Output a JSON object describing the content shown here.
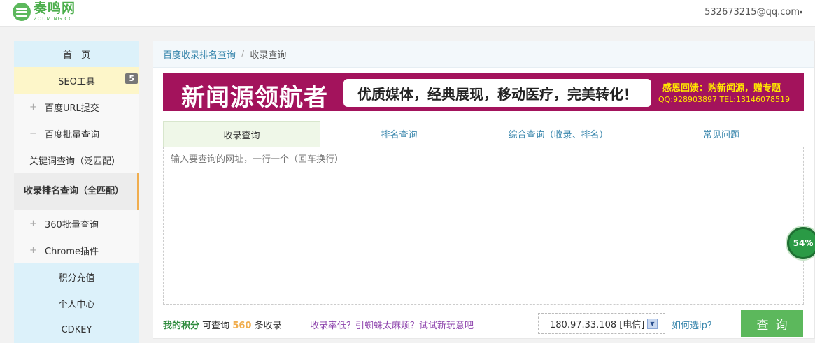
{
  "header": {
    "logo_cn": "奏鸣网",
    "logo_en": "ZOUMING.CC",
    "user_email": "532673215@qq.com"
  },
  "sidebar": {
    "items": [
      {
        "label": "首　页"
      },
      {
        "label": "SEO工具",
        "badge": "5"
      },
      {
        "label": "百度URL提交",
        "prefix": "+"
      },
      {
        "label": "百度批量查询",
        "prefix": "−"
      },
      {
        "label": "关键词查询（泛匹配）"
      },
      {
        "label": "收录排名查询（全匹配）"
      },
      {
        "label": "360批量查询",
        "prefix": "+"
      },
      {
        "label": "Chrome插件",
        "prefix": "+"
      },
      {
        "label": "积分充值"
      },
      {
        "label": "个人中心"
      },
      {
        "label": "CDKEY"
      }
    ]
  },
  "breadcrumb": {
    "parent": "百度收录排名查询",
    "separator": "/",
    "current": "收录查询"
  },
  "banner": {
    "headline": "新闻源领航者",
    "slogan": "优质媒体，经典展现，移动医疗，完美转化！",
    "promo": "感恩回馈：购新闻源，赠专题",
    "contact": "QQ:928903897 TEL:13146078519"
  },
  "tabs": [
    {
      "label": "收录查询",
      "active": true
    },
    {
      "label": "排名查询"
    },
    {
      "label": "综合查询（收录、排名）"
    },
    {
      "label": "常见问题"
    }
  ],
  "query_input": {
    "placeholder": "输入要查询的网址，一行一个（回车换行）",
    "value": ""
  },
  "footer": {
    "points_label": "我的积分",
    "points_text_pre": "可查询",
    "points_value": "560",
    "points_text_post": "条收录",
    "tip_link": "收录率低？引蜘蛛太麻烦？试试新玩意吧",
    "ip_selected": "180.97.33.108 [电信]",
    "ip_help": "如何选ip？",
    "query_button": "查询"
  },
  "progress": {
    "label": "54%",
    "value": 54
  },
  "colors": {
    "brand_green": "#5cb85c",
    "banner_bg": "#a3135c",
    "link_blue": "#3a87ad",
    "sidebar_blue": "#dcf1fa",
    "sidebar_yellow": "#fdf6c9"
  }
}
